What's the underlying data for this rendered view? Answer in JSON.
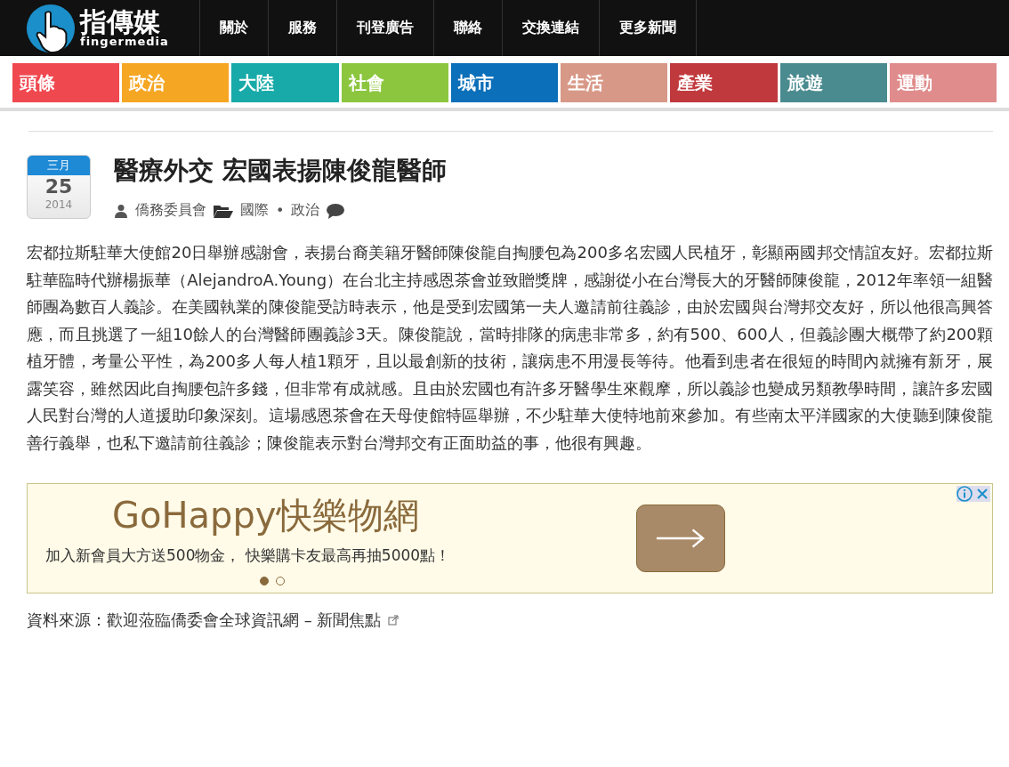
{
  "header": {
    "logo_text": "指傳媒",
    "logo_subtext": "fingermedia",
    "nav": [
      "關於",
      "服務",
      "刊登廣告",
      "聯絡",
      "交換連結",
      "更多新聞"
    ]
  },
  "categories": [
    {
      "label": "頭條",
      "color": "#f0484f"
    },
    {
      "label": "政治",
      "color": "#f5a623"
    },
    {
      "label": "大陸",
      "color": "#17aaa8"
    },
    {
      "label": "社會",
      "color": "#8cc63f"
    },
    {
      "label": "城市",
      "color": "#0b6fb9"
    },
    {
      "label": "生活",
      "color": "#d89887"
    },
    {
      "label": "產業",
      "color": "#c0393d"
    },
    {
      "label": "旅遊",
      "color": "#4a8b8f"
    },
    {
      "label": "運動",
      "color": "#e08c8c"
    }
  ],
  "article": {
    "date": {
      "month": "三月",
      "day": "25",
      "year": "2014"
    },
    "title": "醫療外交 宏國表揚陳俊龍醫師",
    "author": "僑務委員會",
    "categories": [
      "國際",
      "政治"
    ],
    "separator": "•",
    "body": "宏都拉斯駐華大使館20日舉辦感謝會，表揚台裔美籍牙醫師陳俊龍自掏腰包為200多名宏國人民植牙，彰顯兩國邦交情誼友好。宏都拉斯駐華臨時代辦楊振華（AlejandroA.Young）在台北主持感恩茶會並致贈獎牌，感謝從小在台灣長大的牙醫師陳俊龍，2012年率領一組醫師團為數百人義診。在美國執業的陳俊龍受訪時表示，他是受到宏國第一夫人邀請前往義診，由於宏國與台灣邦交友好，所以他很高興答應，而且挑選了一組10餘人的台灣醫師團義診3天。陳俊龍說，當時排隊的病患非常多，約有500、600人，但義診團大概帶了約200顆植牙體，考量公平性，為200多人每人植1顆牙，且以最創新的技術，讓病患不用漫長等待。他看到患者在很短的時間內就擁有新牙，展露笑容，雖然因此自掏腰包許多錢，但非常有成就感。且由於宏國也有許多牙醫學生來觀摩，所以義診也變成另類教學時間，讓許多宏國人民對台灣的人道援助印象深刻。這場感恩茶會在天母使館特區舉辦，不少駐華大使特地前來參加。有些南太平洋國家的大使聽到陳俊龍善行義舉，也私下邀請前往義診；陳俊龍表示對台灣邦交有正面助益的事，他很有興趣。"
  },
  "ad": {
    "title": "GoHappy快樂物網",
    "text": "加入新會員大方送500物金， 快樂購卡友最高再抽5000點！",
    "dots": [
      {
        "selected": true
      },
      {
        "selected": false
      }
    ]
  },
  "source": {
    "label": "資料來源：",
    "link": "歡迎蒞臨僑委會全球資訊網 – 新聞焦點"
  }
}
